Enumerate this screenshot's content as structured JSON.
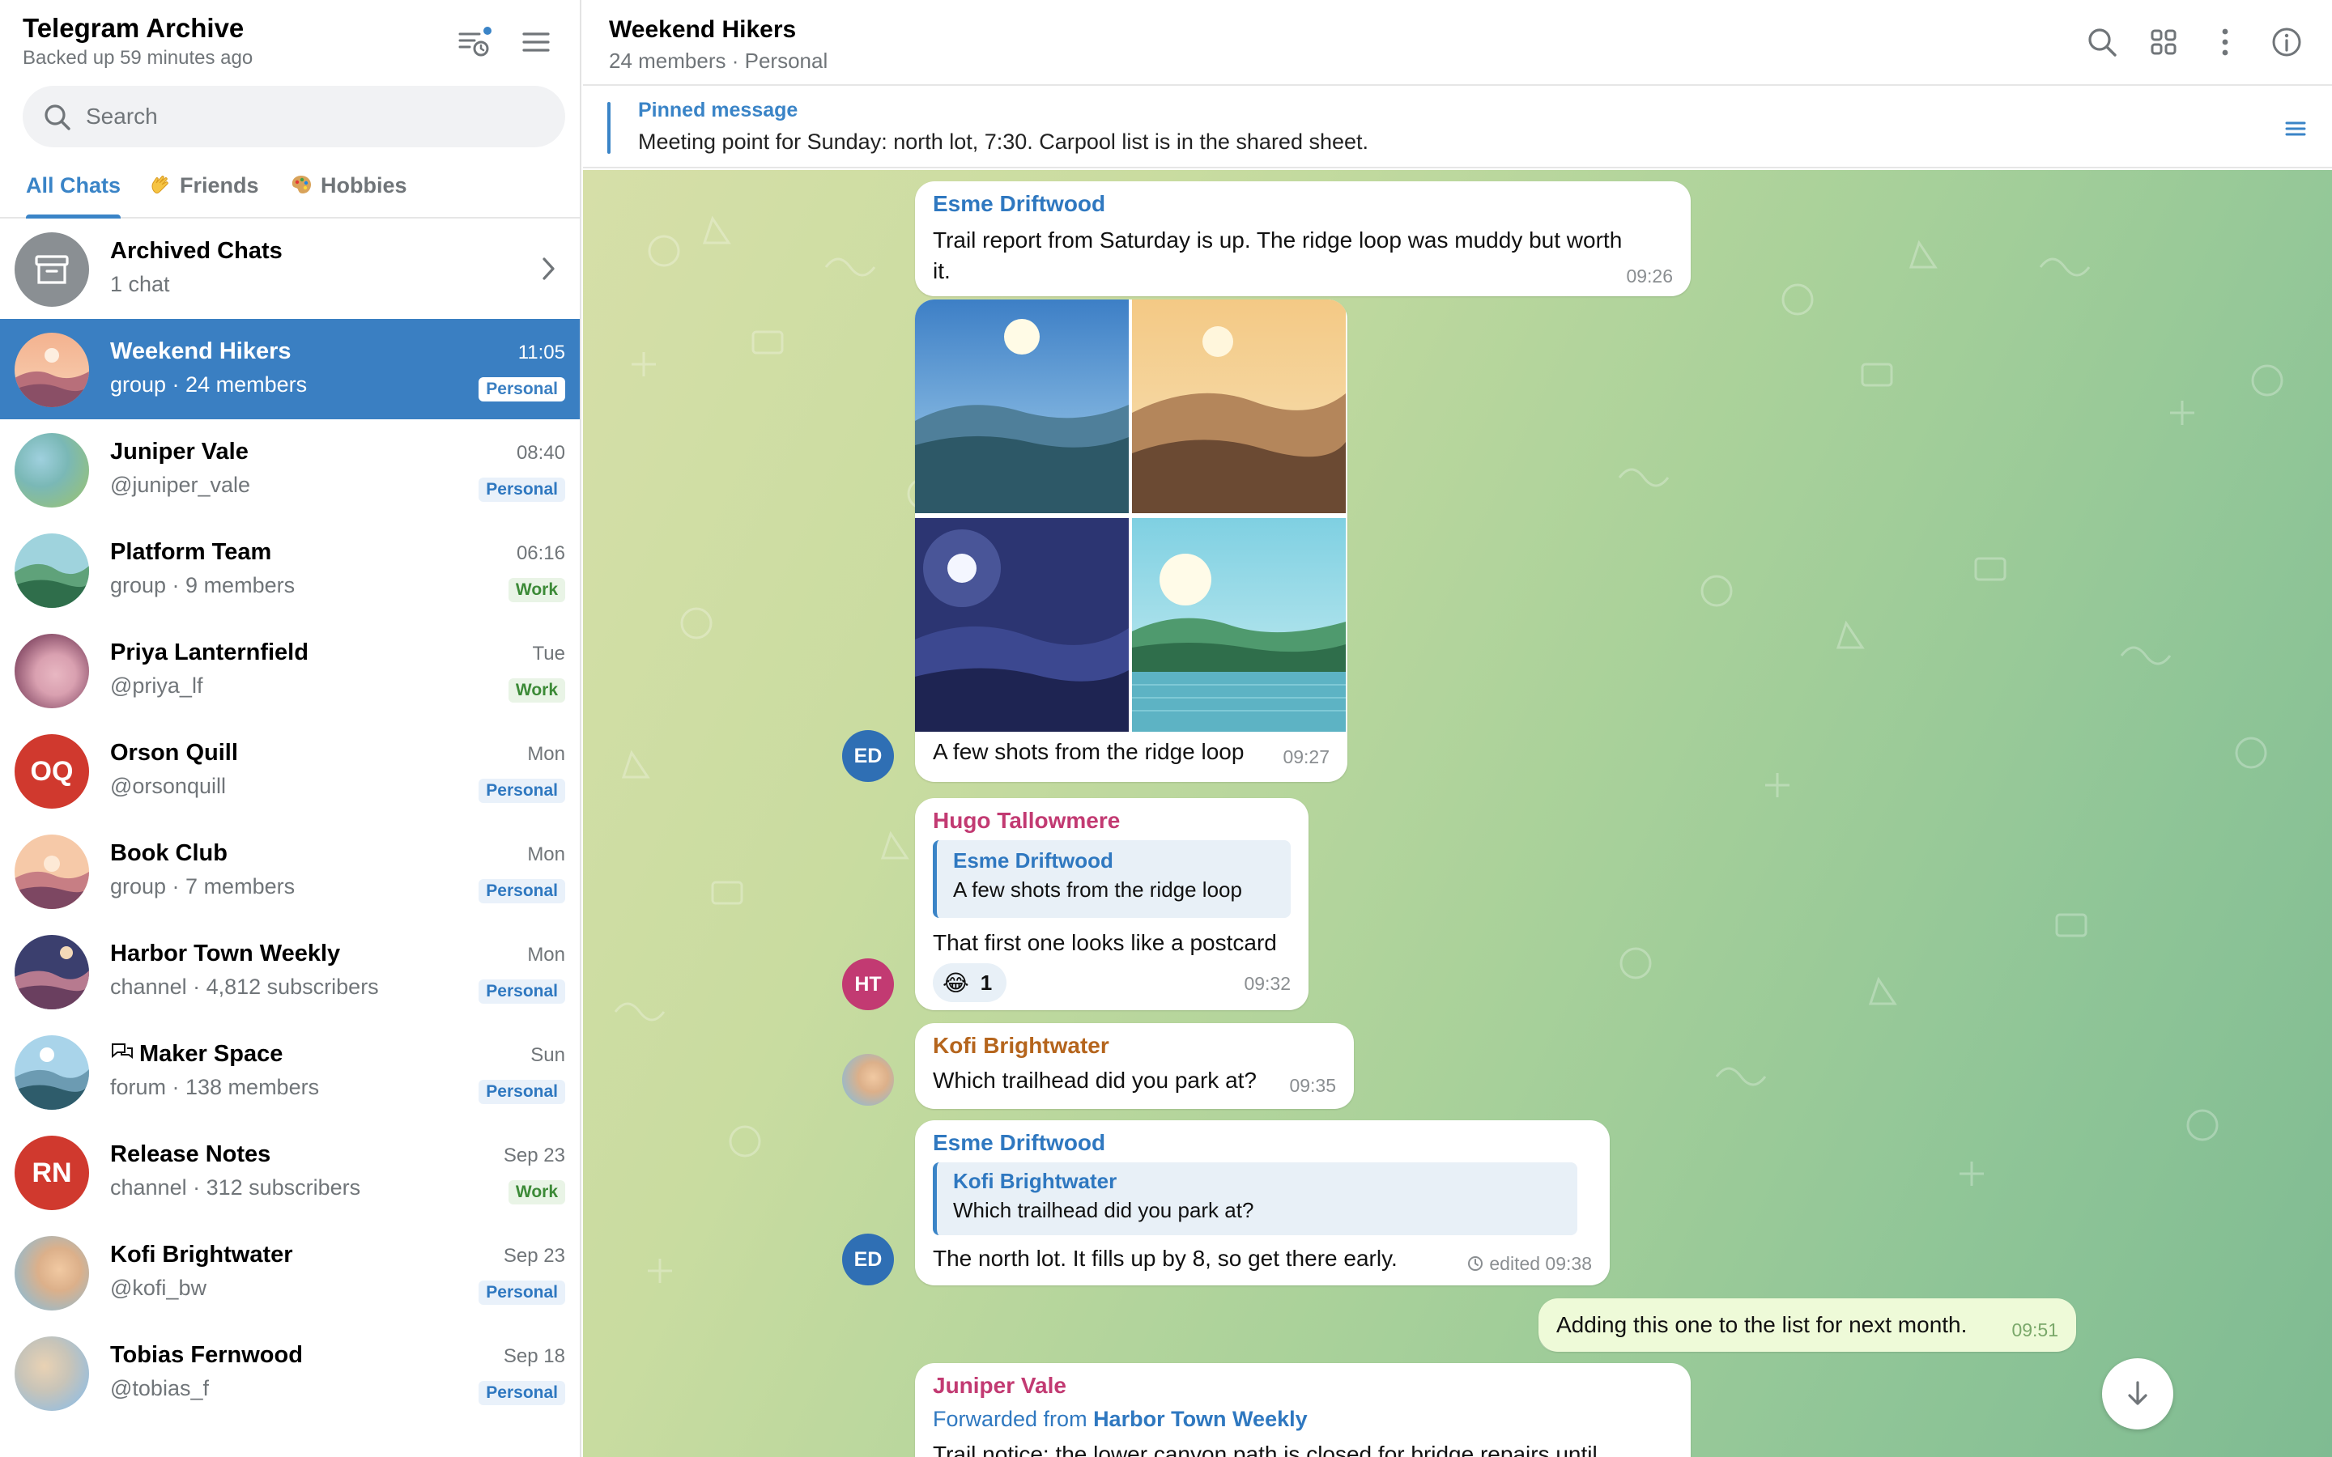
{
  "sidebar": {
    "title": "Telegram Archive",
    "subtitle": "Backed up 59 minutes ago",
    "search_placeholder": "Search",
    "tabs": [
      {
        "label": "All Chats"
      },
      {
        "label": "Friends",
        "emoji": "waving-hand"
      },
      {
        "label": "Hobbies",
        "emoji": "palette"
      }
    ],
    "archived": {
      "name": "Archived Chats",
      "sub": "1 chat"
    },
    "chats": [
      {
        "name": "Weekend Hikers",
        "sub": "group · 24 members",
        "time": "11:05",
        "tag": "Personal"
      },
      {
        "name": "Juniper Vale",
        "sub": "@juniper_vale",
        "time": "08:40",
        "tag": "Personal"
      },
      {
        "name": "Platform Team",
        "sub": "group · 9 members",
        "time": "06:16",
        "tag": "Work"
      },
      {
        "name": "Priya Lanternfield",
        "sub": "@priya_lf",
        "time": "Tue",
        "tag": "Work"
      },
      {
        "name": "Orson Quill",
        "sub": "@orsonquill",
        "time": "Mon",
        "tag": "Personal",
        "initials": "OQ"
      },
      {
        "name": "Book Club",
        "sub": "group · 7 members",
        "time": "Mon",
        "tag": "Personal"
      },
      {
        "name": "Harbor Town Weekly",
        "sub": "channel · 4,812 subscribers",
        "time": "Mon",
        "tag": "Personal"
      },
      {
        "name": "Maker Space",
        "sub": "forum · 138 members",
        "time": "Sun",
        "tag": "Personal"
      },
      {
        "name": "Release Notes",
        "sub": "channel · 312 subscribers",
        "time": "Sep 23",
        "tag": "Work",
        "initials": "RN"
      },
      {
        "name": "Kofi Brightwater",
        "sub": "@kofi_bw",
        "time": "Sep 23",
        "tag": "Personal"
      },
      {
        "name": "Tobias Fernwood",
        "sub": "@tobias_f",
        "time": "Sep 18",
        "tag": "Personal"
      }
    ]
  },
  "chat": {
    "title": "Weekend Hikers",
    "subtitle": "24 members · Personal",
    "pinned": {
      "label": "Pinned message",
      "text": "Meeting point for Sunday: north lot, 7:30. Carpool list is in the shared sheet."
    },
    "messages": [
      {
        "author": "Esme Driftwood",
        "text_line1": "Trail report from Saturday is up. The ridge loop was muddy but worth",
        "text_line2": "it.",
        "time": "09:26"
      },
      {
        "author_initials": "ED",
        "caption": "A few shots from the ridge loop",
        "time": "09:27"
      },
      {
        "author": "Hugo Tallowmere",
        "author_initials": "HT",
        "reply_name": "Esme Driftwood",
        "reply_text": "A few shots from the ridge loop",
        "text": "That first one looks like a postcard",
        "reaction_emoji": "😂",
        "reaction_count": "1",
        "time": "09:32"
      },
      {
        "author": "Kofi Brightwater",
        "text": "Which trailhead did you park at?",
        "time": "09:35"
      },
      {
        "author": "Esme Driftwood",
        "author_initials": "ED",
        "reply_name": "Kofi Brightwater",
        "reply_text": "Which trailhead did you park at?",
        "text": "The north lot. It fills up by 8, so get there early.",
        "time": "edited 09:38"
      },
      {
        "outgoing": true,
        "text": "Adding this one to the list for next month.",
        "time": "09:51"
      },
      {
        "author": "Juniper Vale",
        "forward_prefix": "Forwarded from ",
        "forward_source": "Harbor Town Weekly",
        "text": "Trail notice: the lower canyon path is closed for bridge repairs until"
      }
    ]
  },
  "colors": {
    "accent": "#3a84c7",
    "selected_row": "#3a7fc2",
    "esme": "#2f78c0",
    "hugo": "#c23a72",
    "kofi": "#b5651d",
    "juniper": "#c23a72",
    "outgoing_bubble": "#eefad8"
  }
}
